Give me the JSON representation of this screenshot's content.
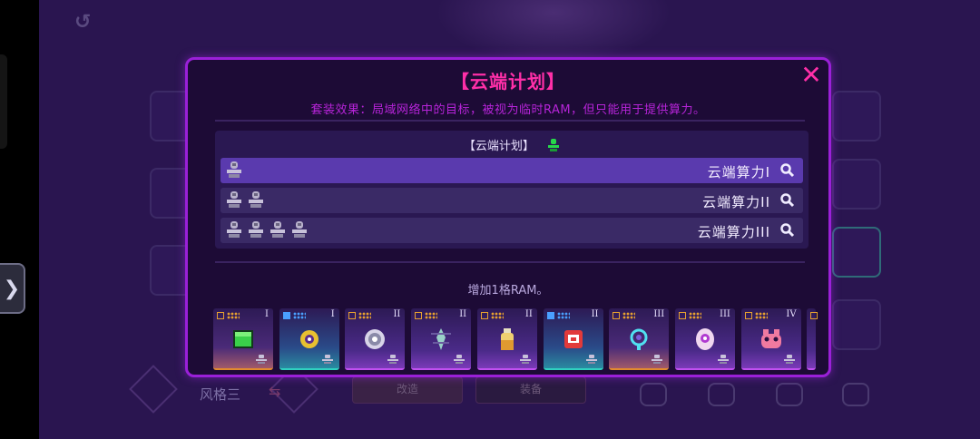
{
  "background": {
    "style_label": "风格三",
    "buttons": [
      "改造",
      "装备"
    ]
  },
  "dialog": {
    "title": "【云端计划】",
    "close_symbol": "✕",
    "set_effect": "套装效果：局域网络中的目标，被视为临时RAM，但只能用于提供算力。",
    "tier_header": "【云端计划】",
    "tiers": [
      {
        "name": "云端算力I",
        "pips": 1,
        "active": true
      },
      {
        "name": "云端算力II",
        "pips": 2,
        "active": false
      },
      {
        "name": "云端算力III",
        "pips": 4,
        "active": false
      }
    ],
    "description": "增加1格RAM。"
  },
  "items": [
    {
      "tier": "I",
      "rarity": "gold",
      "icon": "green-cube-icon"
    },
    {
      "tier": "I",
      "rarity": "teal",
      "icon": "yellow-eye-drone-icon"
    },
    {
      "tier": "II",
      "rarity": "purple",
      "icon": "white-orb-icon"
    },
    {
      "tier": "II",
      "rarity": "purple",
      "icon": "antenna-crystal-icon"
    },
    {
      "tier": "II",
      "rarity": "purple",
      "icon": "potion-bottle-icon"
    },
    {
      "tier": "II",
      "rarity": "teal",
      "icon": "red-chip-icon"
    },
    {
      "tier": "III",
      "rarity": "gold",
      "icon": "cyan-coil-icon"
    },
    {
      "tier": "III",
      "rarity": "purple",
      "icon": "pink-capsule-icon"
    },
    {
      "tier": "IV",
      "rarity": "purple",
      "icon": "pink-creature-icon"
    }
  ],
  "colors": {
    "accent_pink": "#ff2fa8",
    "border_purple": "#9a20d8",
    "set_effect_text": "#b624d8",
    "active_row": "#5a3aae",
    "set_active_green": "#27d84a"
  }
}
